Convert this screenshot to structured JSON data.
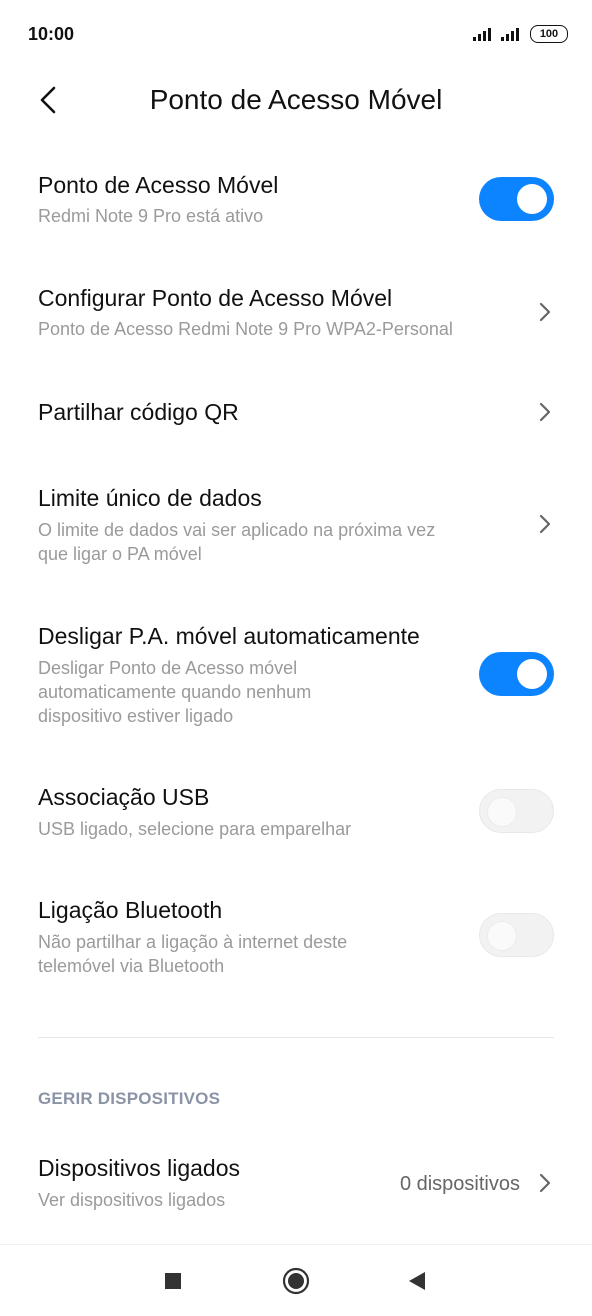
{
  "status_bar": {
    "time": "10:00",
    "battery": "100"
  },
  "header": {
    "title": "Ponto de Acesso Móvel"
  },
  "settings": {
    "hotspot": {
      "title": "Ponto de Acesso Móvel",
      "subtitle": "Redmi Note 9 Pro está ativo",
      "toggle": "on"
    },
    "configure": {
      "title": "Configurar Ponto de Acesso Móvel",
      "subtitle": "Ponto de Acesso Redmi Note 9 Pro WPA2-Personal"
    },
    "share_qr": {
      "title": "Partilhar código QR"
    },
    "data_limit": {
      "title": "Limite único de dados",
      "subtitle_line1": "O limite de dados vai ser aplicado na próxima vez",
      "subtitle_line2": "que ligar o PA móvel"
    },
    "auto_off": {
      "title": "Desligar P.A. móvel automaticamente",
      "subtitle_line1": "Desligar Ponto de Acesso móvel",
      "subtitle_line2": "automaticamente quando nenhum",
      "subtitle_line3": "dispositivo estiver ligado",
      "toggle": "on"
    },
    "usb": {
      "title": "Associação USB",
      "subtitle": "USB ligado, selecione para emparelhar",
      "toggle": "off"
    },
    "bluetooth": {
      "title": "Ligação Bluetooth",
      "subtitle_line1": "Não partilhar a ligação à internet deste",
      "subtitle_line2": "telemóvel via Bluetooth",
      "toggle": "off"
    }
  },
  "manage_section": {
    "header": "GERIR DISPOSITIVOS",
    "connected": {
      "title": "Dispositivos ligados",
      "subtitle": "Ver dispositivos ligados",
      "value": "0 dispositivos"
    }
  },
  "nav_bar": {
    "icons": [
      "recents-square-icon",
      "home-circle-icon",
      "back-triangle-icon"
    ]
  },
  "colors": {
    "accent": "#0d84ff",
    "subtitle": "#9a9a9a",
    "section": "#8a94a6"
  }
}
